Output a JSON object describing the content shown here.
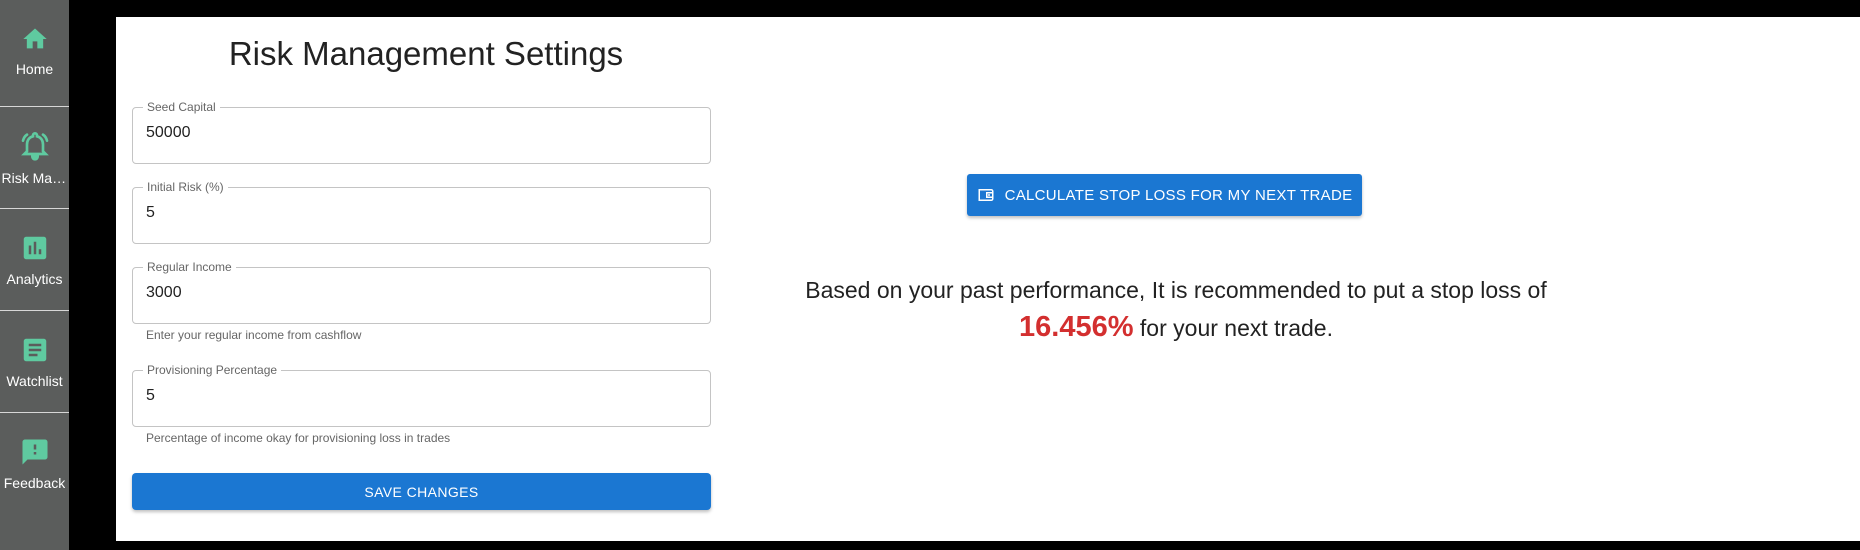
{
  "sidebar": {
    "items": [
      {
        "label": "Home",
        "icon": "home-icon"
      },
      {
        "label": "Risk Management",
        "icon": "alarm-bell-icon"
      },
      {
        "label": "Analytics",
        "icon": "bar-chart-icon"
      },
      {
        "label": "Watchlist",
        "icon": "article-icon"
      },
      {
        "label": "Feedback",
        "icon": "feedback-icon"
      }
    ],
    "icon_color": "#5fcaa0"
  },
  "page": {
    "title": "Risk Management Settings"
  },
  "form": {
    "seed_capital": {
      "label": "Seed Capital",
      "value": "50000"
    },
    "initial_risk": {
      "label": "Initial Risk (%)",
      "value": "5"
    },
    "regular_income": {
      "label": "Regular Income",
      "value": "3000",
      "helper": "Enter your regular income from cashflow"
    },
    "provisioning": {
      "label": "Provisioning Percentage",
      "value": "5",
      "helper": "Percentage of income okay for provisioning loss in trades"
    },
    "save_label": "SAVE CHANGES"
  },
  "calculator": {
    "button_label": "CALCULATE STOP LOSS FOR MY NEXT TRADE",
    "reco_prefix": "Based on your past performance, It is recommended to put a stop loss of",
    "reco_value": "16.456%",
    "reco_suffix": " for your next trade."
  },
  "colors": {
    "primary": "#1b77d2",
    "highlight": "#d32f2f",
    "sidebar_bg": "#5b5d5c"
  }
}
